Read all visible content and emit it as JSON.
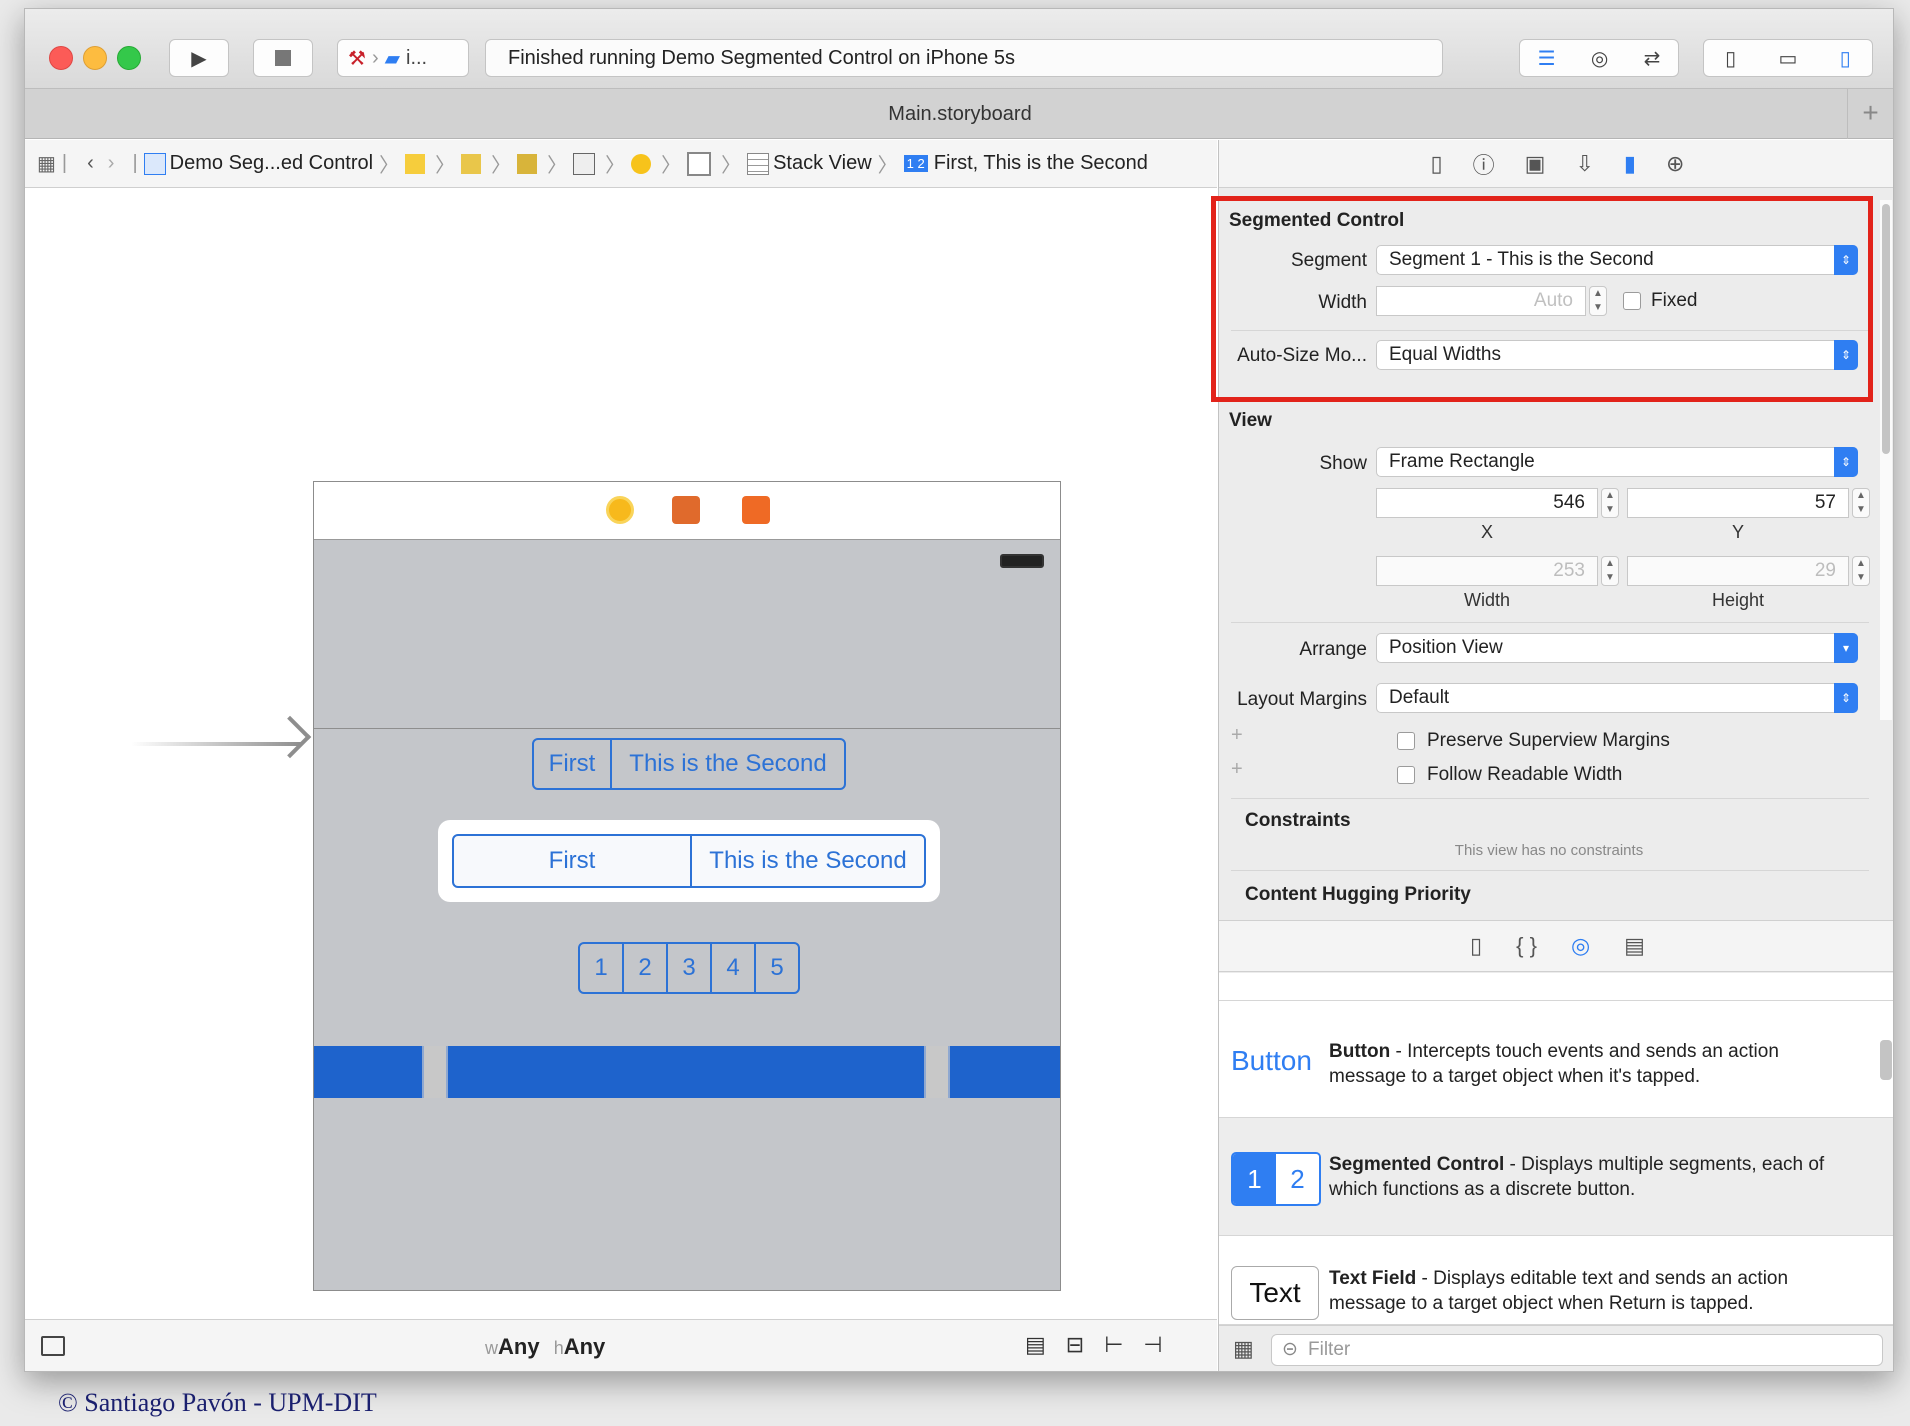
{
  "window": {
    "status": "Finished running Demo Segmented Control on iPhone 5s",
    "scheme": "i...",
    "tab_title": "Main.storyboard"
  },
  "jumpbar": {
    "items": [
      "Demo Seg...ed Control",
      "Stack View",
      "First, This is the Second"
    ]
  },
  "scene": {
    "seg1": [
      "First",
      "This is the Second"
    ],
    "seg2": [
      "First",
      "This is the Second"
    ],
    "seg3": [
      "1",
      "2",
      "3",
      "4",
      "5"
    ]
  },
  "bottombar": {
    "w_prefix": "w",
    "w_value": "Any",
    "h_prefix": "h",
    "h_value": "Any"
  },
  "inspector": {
    "segmented": {
      "title": "Segmented Control",
      "segment_label": "Segment",
      "segment_value": "Segment 1 - This is the Second",
      "width_label": "Width",
      "width_placeholder": "Auto",
      "fixed_label": "Fixed",
      "autosize_label": "Auto-Size Mo...",
      "autosize_value": "Equal Widths"
    },
    "view": {
      "title": "View",
      "show_label": "Show",
      "show_value": "Frame Rectangle",
      "x_value": "546",
      "y_value": "57",
      "x_label": "X",
      "y_label": "Y",
      "width_value": "253",
      "height_value": "29",
      "width_label": "Width",
      "height_label": "Height",
      "arrange_label": "Arrange",
      "arrange_value": "Position View",
      "margins_label": "Layout Margins",
      "margins_value": "Default",
      "preserve_label": "Preserve Superview Margins",
      "readable_label": "Follow Readable Width",
      "constraints_title": "Constraints",
      "constraints_note": "This view has no constraints",
      "hugging_title": "Content Hugging Priority"
    },
    "library": [
      {
        "icon_text": "Button",
        "name": "Button",
        "desc": " - Intercepts touch events and sends an action message to a target object when it's tapped."
      },
      {
        "icon_text_1": "1",
        "icon_text_2": "2",
        "name": "Segmented Control",
        "desc": " - Displays multiple segments, each of which functions as a discrete button."
      },
      {
        "icon_text": "Text",
        "name": "Text Field",
        "desc": " - Displays editable text and sends an action message to a target object when Return is tapped."
      }
    ],
    "filter_placeholder": "Filter"
  },
  "footer": {
    "copyright": "© Santiago Pavón - UPM-DIT"
  },
  "colors": {
    "accent": "#2c72d6",
    "highlight_box": "#e2231a",
    "bar": "#1e63cc"
  }
}
